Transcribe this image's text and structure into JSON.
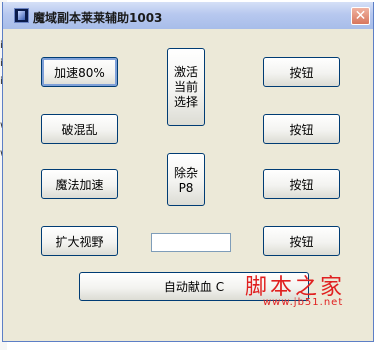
{
  "window": {
    "title": "魔域副本莱莱辅助1003",
    "close_glyph": "✕"
  },
  "left_edge_fragments": [
    "ii",
    "i",
    "i",
    "w",
    "w"
  ],
  "buttons": {
    "speed": "加速80%",
    "break_chaos": "破混乱",
    "magic_speed": "魔法加速",
    "expand_view": "扩大视野",
    "activate_current": "激活当前选择",
    "remove_p8": "除杂P8",
    "btn1": "按钮",
    "btn2": "按钮",
    "btn3": "按钮",
    "btn4": "按钮",
    "auto_blood": "自动献血 C"
  },
  "input": {
    "value": ""
  },
  "watermark": {
    "main": "脚本之家",
    "url": "www.jb51.net"
  }
}
